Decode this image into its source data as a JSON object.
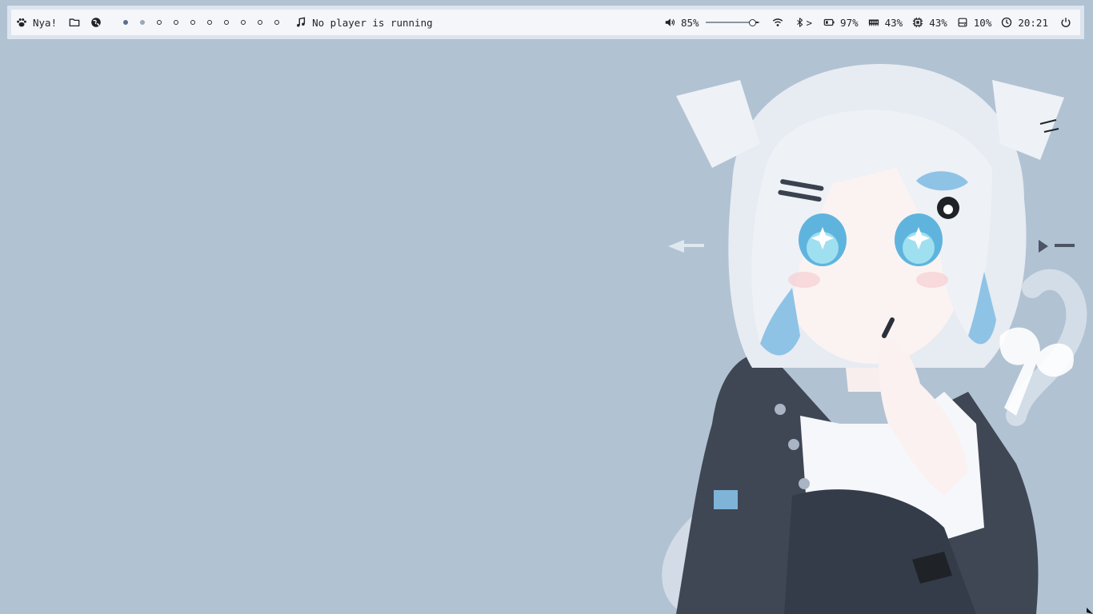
{
  "bar": {
    "launcher": {
      "icon": "paw-icon",
      "label": "Nya!"
    },
    "files": {
      "icon": "folder-icon"
    },
    "browser": {
      "icon": "globe-icon"
    },
    "workspaces": [
      {
        "state": "active"
      },
      {
        "state": "occupied"
      },
      {
        "state": "empty"
      },
      {
        "state": "empty"
      },
      {
        "state": "empty"
      },
      {
        "state": "empty"
      },
      {
        "state": "empty"
      },
      {
        "state": "empty"
      },
      {
        "state": "empty"
      },
      {
        "state": "empty"
      }
    ],
    "media": {
      "icon": "music-note-icon",
      "label": "No player is running"
    },
    "volume": {
      "icon": "speaker-icon",
      "label": "85%",
      "level": 0.85
    },
    "wifi": {
      "icon": "wifi-icon"
    },
    "bluetooth": {
      "icon": "bluetooth-icon",
      "label": ">"
    },
    "battery": {
      "icon": "battery-icon",
      "label": "97%"
    },
    "memory": {
      "icon": "memory-icon",
      "label": "43%"
    },
    "cpu": {
      "icon": "cpu-icon",
      "label": "43%"
    },
    "disk": {
      "icon": "disk-icon",
      "label": "10%"
    },
    "clock": {
      "icon": "clock-icon",
      "label": "20:21"
    },
    "power": {
      "icon": "power-icon"
    }
  },
  "colors": {
    "desktop_bg": "#b1c2d3",
    "bar_bg": "#f4f6f9",
    "bar_border": "#dce4ee",
    "text": "#1f2328",
    "ws_active": "#5b6e8c",
    "ws_occupied": "#9aa7b8"
  },
  "wallpaper": {
    "subject": "anime cat-ear girl illustration"
  }
}
